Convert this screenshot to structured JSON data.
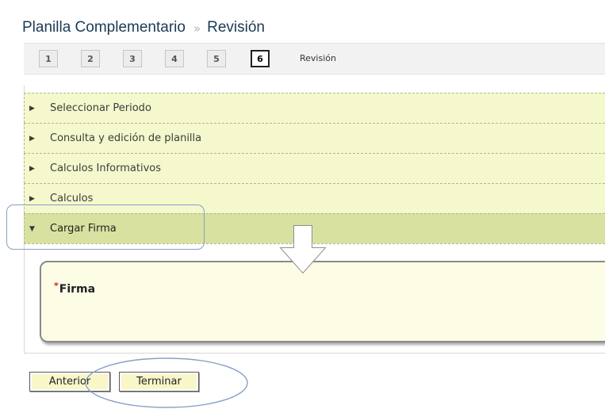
{
  "header": {
    "title": "Planilla Complementario",
    "separator": "»",
    "current": "Revisión"
  },
  "steps": [
    {
      "label": "1"
    },
    {
      "label": "2"
    },
    {
      "label": "3"
    },
    {
      "label": "4"
    },
    {
      "label": "5"
    },
    {
      "label": "6",
      "current": true,
      "caption": "Revisión"
    }
  ],
  "accordion": {
    "items": [
      {
        "label": "Seleccionar Periodo",
        "expanded": false
      },
      {
        "label": "Consulta y edición de planilla",
        "expanded": false
      },
      {
        "label": "Calculos Informativos",
        "expanded": false
      },
      {
        "label": "Calculos",
        "expanded": false
      },
      {
        "label": "Cargar Firma",
        "expanded": true
      }
    ]
  },
  "form": {
    "required_marker": "*",
    "firma_label": "Firma"
  },
  "buttons": {
    "anterior": "Anterior",
    "terminar": "Terminar"
  },
  "icons": {
    "collapsed": "chevron-right-icon",
    "expanded": "chevron-down-icon"
  },
  "colors": {
    "accordion_bg": "#f4f8cc",
    "accordion_open_bg": "#d8e1a0",
    "form_box_bg": "#fdfde6",
    "button_bg": "#f9f7c8",
    "required": "#d21d1d",
    "annotation": "#8a9fc7"
  }
}
